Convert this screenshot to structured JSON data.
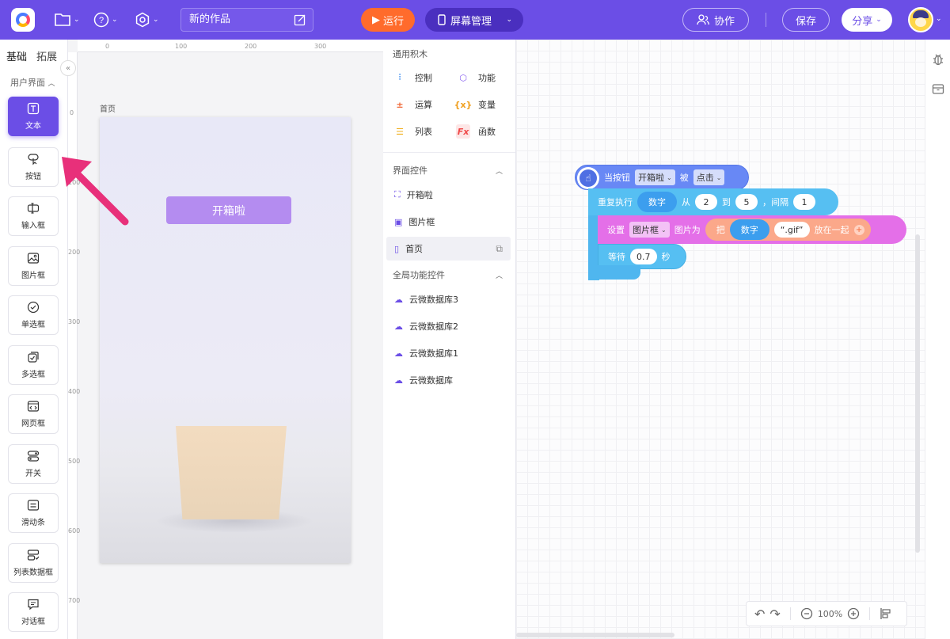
{
  "topbar": {
    "project_title": "新的作品",
    "run_label": "运行",
    "screen_manage_label": "屏幕管理",
    "collab_label": "协作",
    "save_label": "保存",
    "share_label": "分享"
  },
  "left_panel": {
    "tabs": [
      "基础",
      "拓展"
    ],
    "section_title": "用户界面",
    "components": [
      "文本",
      "按钮",
      "输入框",
      "图片框",
      "单选框",
      "多选框",
      "网页框",
      "开关",
      "滑动条",
      "列表数据框",
      "对话框"
    ]
  },
  "canvas": {
    "ruler_top": [
      "0",
      "100",
      "200",
      "300"
    ],
    "ruler_left": [
      "0",
      "100",
      "200",
      "300",
      "400",
      "500",
      "600",
      "700"
    ],
    "page_label": "首页",
    "phone_button_label": "开箱啦"
  },
  "palette": {
    "general_title": "通用积木",
    "categories": [
      {
        "label": "控制",
        "icon": "sliders-icon",
        "color": "#3c8cf0"
      },
      {
        "label": "功能",
        "icon": "cube-icon",
        "color": "#8a62f0"
      },
      {
        "label": "运算",
        "icon": "operator-icon",
        "color": "#f06a3a"
      },
      {
        "label": "变量",
        "icon": "variable-icon",
        "color": "#f0a020"
      },
      {
        "label": "列表",
        "icon": "list-icon",
        "color": "#f0b020"
      },
      {
        "label": "函数",
        "icon": "function-icon",
        "color": "#f04a4a"
      }
    ],
    "ui_controls_title": "界面控件",
    "ui_controls": [
      "开箱啦",
      "图片框",
      "首页"
    ],
    "global_controls_title": "全局功能控件",
    "global_controls": [
      "云微数据库3",
      "云微数据库2",
      "云微数据库1",
      "云微数据库"
    ]
  },
  "blocks": {
    "event": {
      "prefix": "当按钮",
      "target": "开箱啦",
      "middle": "被",
      "action": "点击"
    },
    "loop": {
      "label": "重复执行",
      "var": "数字",
      "from_label": "从",
      "from": "2",
      "to_label": "到",
      "to": "5",
      "step_label": "，间隔",
      "step": "1"
    },
    "set": {
      "label": "设置",
      "target": "图片框",
      "prop": "图片为",
      "join_label": "把",
      "join_var": "数字",
      "join_text": "“.gif”",
      "join_suffix": "放在一起"
    },
    "wait": {
      "label": "等待",
      "value": "0.7",
      "unit": "秒"
    }
  },
  "zoom": {
    "level": "100%"
  }
}
